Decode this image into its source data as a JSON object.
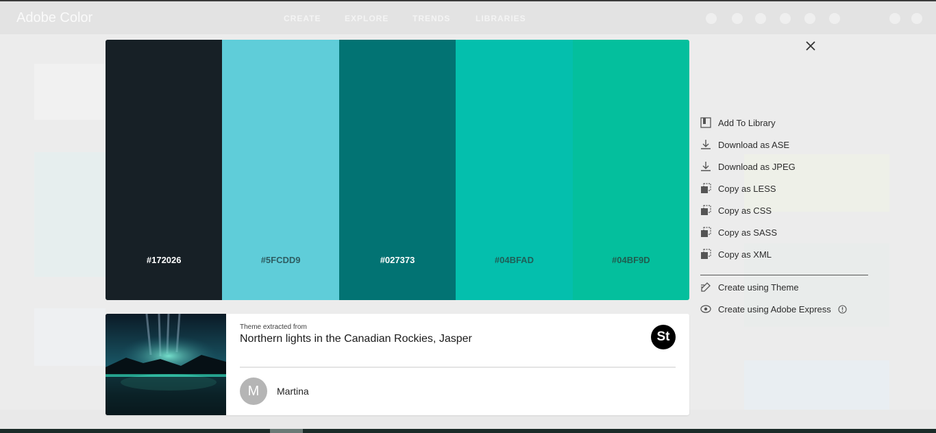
{
  "background": {
    "app_title": "Adobe Color",
    "nav_tabs": [
      "CREATE",
      "EXPLORE",
      "TRENDS",
      "LIBRARIES"
    ]
  },
  "palette": {
    "swatches": [
      {
        "hex": "#172026",
        "color": "#172026",
        "label_color": "#ffffff"
      },
      {
        "hex": "#5FCDD9",
        "color": "#5FCDD9",
        "label_color": "#2e5d62"
      },
      {
        "hex": "#027373",
        "color": "#027373",
        "label_color": "#ffffff"
      },
      {
        "hex": "#04BFAD",
        "color": "#04BFAD",
        "label_color": "#1f5e57"
      },
      {
        "hex": "#04BF9D",
        "color": "#04BF9D",
        "label_color": "#1f5e50"
      }
    ]
  },
  "source": {
    "extracted_label": "Theme extracted from",
    "title": "Northern lights in the Canadian Rockies, Jasper",
    "badge": "St",
    "author_initial": "M",
    "author_name": "Martina"
  },
  "actions": [
    {
      "label": "Add To Library",
      "icon": "library-icon"
    },
    {
      "label": "Download as ASE",
      "icon": "download-icon"
    },
    {
      "label": "Download as JPEG",
      "icon": "download-icon"
    },
    {
      "label": "Copy as LESS",
      "icon": "copy-icon"
    },
    {
      "label": "Copy as CSS",
      "icon": "copy-icon"
    },
    {
      "label": "Copy as SASS",
      "icon": "copy-icon"
    },
    {
      "label": "Copy as XML",
      "icon": "copy-icon"
    },
    {
      "label": "Create using Theme",
      "icon": "pen-icon"
    },
    {
      "label": "Create using Adobe Express",
      "icon": "express-icon"
    }
  ]
}
